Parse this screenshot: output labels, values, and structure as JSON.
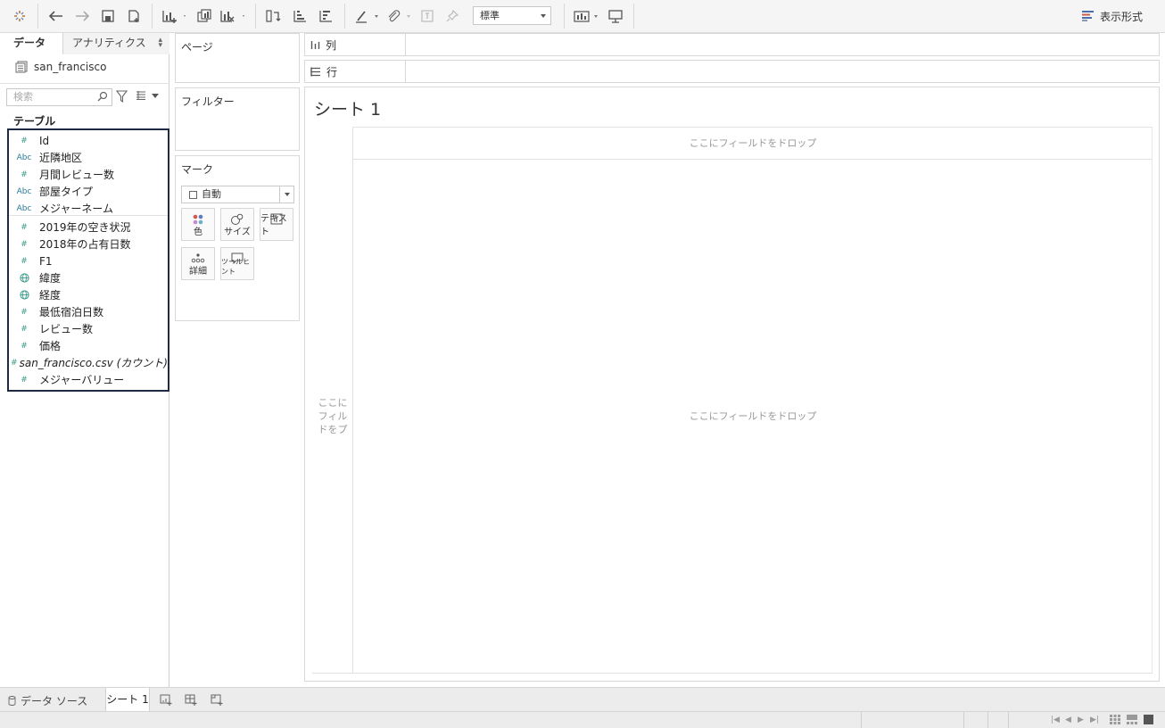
{
  "toolbar": {
    "mark_size_select": "標準",
    "show_me_label": "表示形式"
  },
  "data_pane": {
    "tab_data": "データ",
    "tab_analytics": "アナリティクス",
    "datasource": "san_francisco",
    "search_placeholder": "検索",
    "tables_header": "テーブル",
    "fields": [
      {
        "type": "number",
        "icon": "#",
        "label": "Id"
      },
      {
        "type": "string",
        "icon": "Abc",
        "label": "近隣地区"
      },
      {
        "type": "number",
        "icon": "#",
        "label": "月間レビュー数"
      },
      {
        "type": "string",
        "icon": "Abc",
        "label": "部屋タイプ"
      },
      {
        "type": "string",
        "icon": "Abc",
        "label": "メジャーネーム"
      },
      {
        "type": "number",
        "icon": "#",
        "label": "2019年の空き状況"
      },
      {
        "type": "number",
        "icon": "#",
        "label": "2018年の占有日数"
      },
      {
        "type": "number",
        "icon": "#",
        "label": "F1"
      },
      {
        "type": "geo",
        "icon": "globe",
        "label": "緯度"
      },
      {
        "type": "geo",
        "icon": "globe",
        "label": "経度"
      },
      {
        "type": "number",
        "icon": "#",
        "label": "最低宿泊日数"
      },
      {
        "type": "number",
        "icon": "#",
        "label": "レビュー数"
      },
      {
        "type": "number",
        "icon": "#",
        "label": "価格"
      },
      {
        "type": "number",
        "icon": "#",
        "label": "san_francisco.csv (カウント)"
      },
      {
        "type": "number",
        "icon": "#",
        "label": "メジャーバリュー"
      }
    ]
  },
  "shelves": {
    "pages": "ページ",
    "filters": "フィルター",
    "marks": "マーク",
    "marks_type": "自動",
    "mark_buttons": {
      "color": "色",
      "size": "サイズ",
      "text": "テキスト",
      "detail": "詳細",
      "tooltip": "ツールヒント"
    },
    "columns": "列",
    "rows": "行"
  },
  "sheet": {
    "title": "シート 1",
    "drop_top": "ここにフィールドをドロップ",
    "drop_left": [
      "ここに",
      "フィル",
      "ドをプ"
    ],
    "drop_main": "ここにフィールドをドロップ"
  },
  "tabs": {
    "data_source": "データ ソース",
    "sheet1": "シート 1"
  },
  "colors": {
    "accent_number": "#3a9a8a",
    "accent_string": "#2a7a9a",
    "selection_border": "#1f2a44"
  }
}
